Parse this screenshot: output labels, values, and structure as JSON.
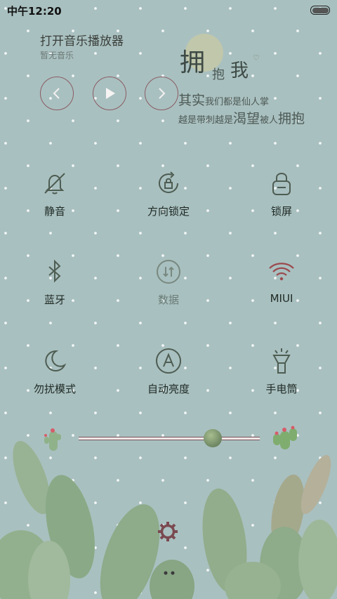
{
  "status": {
    "time": "中午12:20"
  },
  "music": {
    "title": "打开音乐播放器",
    "subtitle": "暂无音乐"
  },
  "decoration": {
    "big1": "拥",
    "small": "抱",
    "big2": "我",
    "line1_big": "其实",
    "line1_rest": "我们都是仙人掌",
    "line2_a": "越是带刺越是",
    "line2_big": "渴望",
    "line2_b": "被人",
    "line2_c": "拥抱"
  },
  "toggles": {
    "mute": "静音",
    "rotation_lock": "方向锁定",
    "lock_screen": "锁屏",
    "bluetooth": "蓝牙",
    "data": "数据",
    "wifi": "MIUI",
    "dnd": "勿扰模式",
    "auto_brightness": "自动亮度",
    "flashlight": "手电筒"
  },
  "brightness": {
    "level_percent": 74
  },
  "colors": {
    "accent_ring": "#8a5c62",
    "icon": "#4e5d52",
    "wifi_red": "#9b4a4e"
  }
}
